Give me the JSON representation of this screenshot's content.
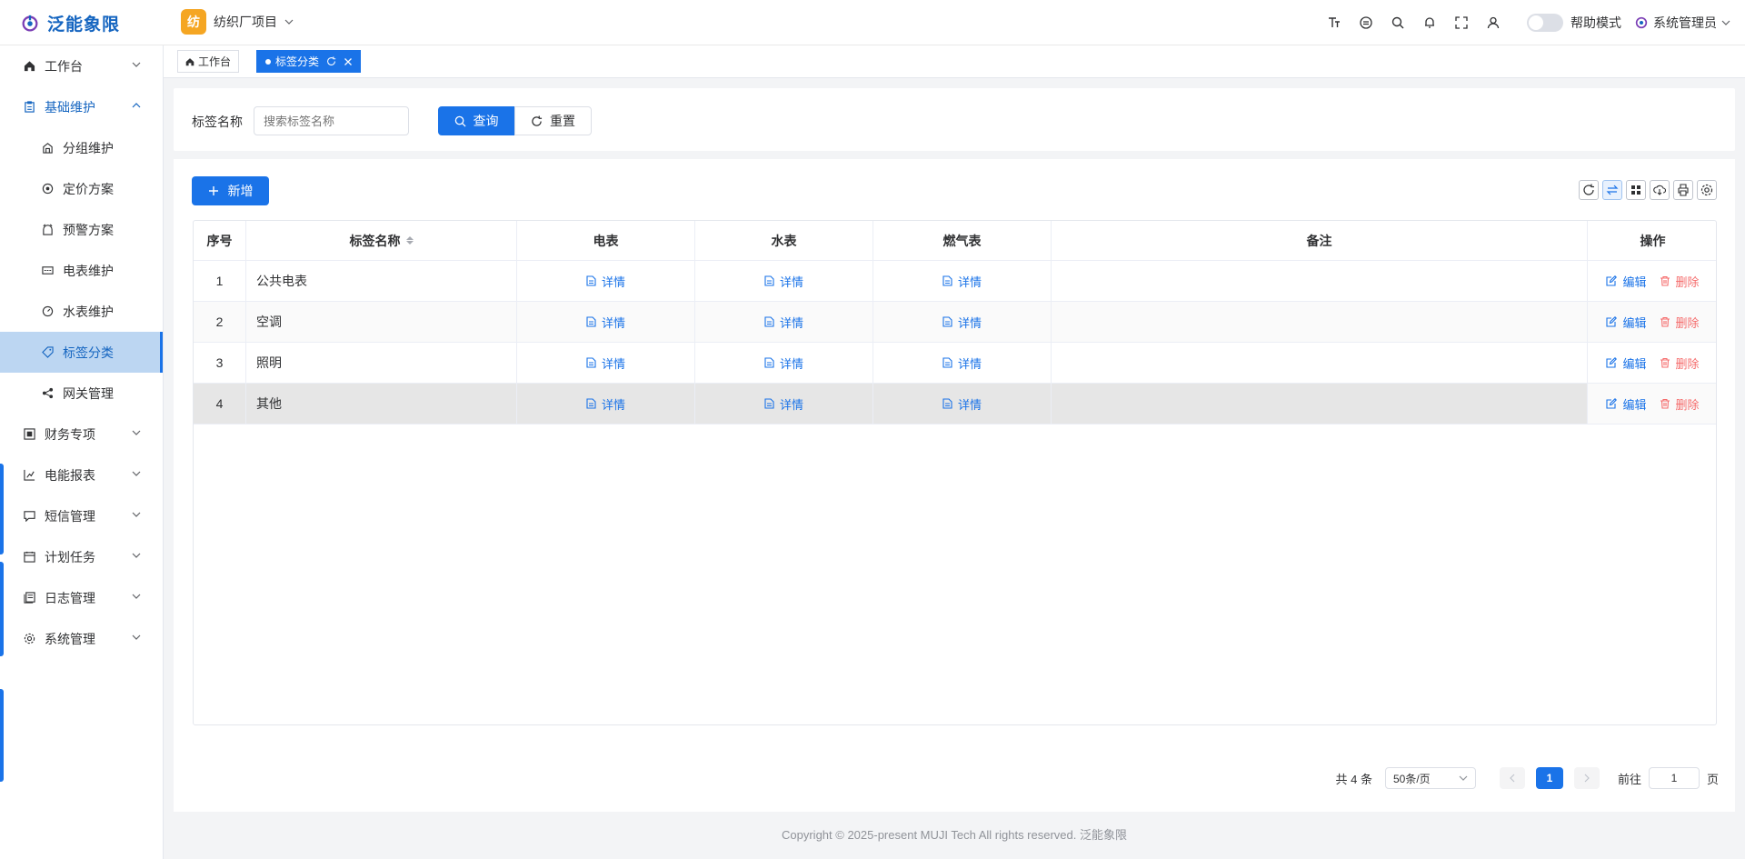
{
  "header": {
    "brand": "泛能象限",
    "project_avatar": "纺",
    "project_name": "纺织厂项目",
    "icons": [
      "font-size-icon",
      "theme-icon",
      "search-icon",
      "bell-icon",
      "fullscreen-icon",
      "user-icon"
    ],
    "help_mode_label": "帮助模式",
    "user_name": "系统管理员"
  },
  "sidebar": {
    "items": [
      {
        "label": "工作台",
        "icon": "home-icon"
      },
      {
        "label": "基础维护",
        "icon": "clipboard-icon"
      },
      {
        "label": "分组维护",
        "icon": "group-icon"
      },
      {
        "label": "定价方案",
        "icon": "price-icon"
      },
      {
        "label": "预警方案",
        "icon": "alarm-icon"
      },
      {
        "label": "电表维护",
        "icon": "meter-icon"
      },
      {
        "label": "水表维护",
        "icon": "gauge-icon"
      },
      {
        "label": "标签分类",
        "icon": "tag-icon"
      },
      {
        "label": "网关管理",
        "icon": "share-icon"
      },
      {
        "label": "财务专项",
        "icon": "finance-icon"
      },
      {
        "label": "电能报表",
        "icon": "report-icon"
      },
      {
        "label": "短信管理",
        "icon": "message-icon"
      },
      {
        "label": "计划任务",
        "icon": "calendar-icon"
      },
      {
        "label": "日志管理",
        "icon": "log-icon"
      },
      {
        "label": "系统管理",
        "icon": "settings-icon"
      }
    ]
  },
  "tabs": [
    {
      "label": "工作台"
    },
    {
      "label": "标签分类"
    }
  ],
  "filter": {
    "label": "标签名称",
    "placeholder": "搜索标签名称",
    "query_label": "查询",
    "reset_label": "重置"
  },
  "toolbar": {
    "add_label": "新增"
  },
  "table": {
    "columns": [
      "序号",
      "标签名称",
      "电表",
      "水表",
      "燃气表",
      "备注",
      "操作"
    ],
    "detail_label": "详情",
    "edit_label": "编辑",
    "delete_label": "删除",
    "rows": [
      {
        "index": "1",
        "name": "公共电表",
        "remark": ""
      },
      {
        "index": "2",
        "name": "空调",
        "remark": ""
      },
      {
        "index": "3",
        "name": "照明",
        "remark": ""
      },
      {
        "index": "4",
        "name": "其他",
        "remark": ""
      }
    ]
  },
  "pagination": {
    "total": "共 4 条",
    "page_size": "50条/页",
    "current_page": "1",
    "goto_label": "前往",
    "goto_value": "1",
    "page_unit": "页"
  },
  "footer": {
    "copyright": "Copyright © 2025-present MUJI Tech All rights reserved. 泛能象限"
  },
  "colors": {
    "primary": "#1a73e8",
    "brand": "#1565c0",
    "danger": "#f56c6c",
    "project_avatar": "#f5a623"
  }
}
